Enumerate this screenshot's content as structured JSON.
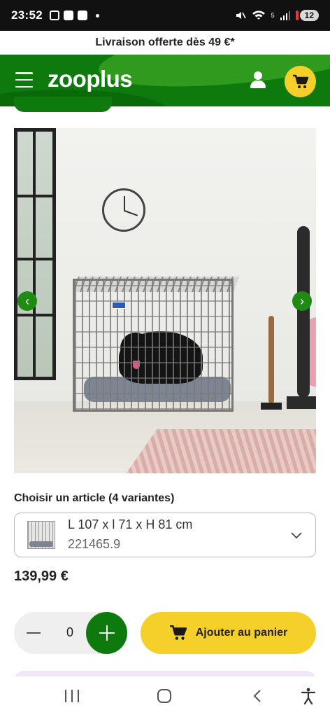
{
  "status_bar": {
    "time": "23:52",
    "battery": "12",
    "signal": "5"
  },
  "promo": {
    "text": "Livraison offerte dès 49 €*"
  },
  "header": {
    "logo": "zooplus",
    "menu_icon": "hamburger-menu-icon",
    "account_icon": "user-icon",
    "cart_icon": "cart-icon",
    "brand_color": "#0e7a0d",
    "cart_color": "#f5cf2a"
  },
  "gallery": {
    "prev_icon": "chevron-left-icon",
    "next_icon": "chevron-right-icon",
    "prev_glyph": "‹",
    "next_glyph": "›"
  },
  "variant": {
    "label": "Choisir un article (4 variantes)",
    "selected_name": "L 107 x l 71 x H 81 cm",
    "selected_sku": "221465.9"
  },
  "price": "139,99 €",
  "quantity": {
    "value": "0"
  },
  "add_to_cart": {
    "label": "Ajouter au panier"
  }
}
